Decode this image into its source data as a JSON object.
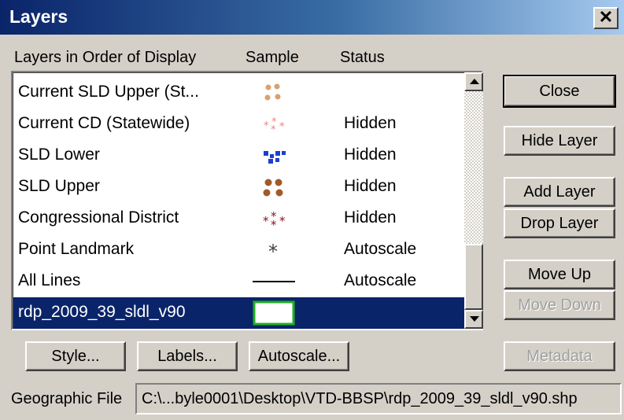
{
  "window": {
    "title": "Layers",
    "close_glyph": "✕"
  },
  "columns": {
    "name": "Layers in Order of Display",
    "sample": "Sample",
    "status": "Status"
  },
  "layers": [
    {
      "name": "Current SLD Upper (St...",
      "sample": "brown-dots",
      "status": ""
    },
    {
      "name": "Current CD (Statewide)",
      "sample": "pink-stars",
      "status": "Hidden"
    },
    {
      "name": "SLD Lower",
      "sample": "blue-squares",
      "status": "Hidden"
    },
    {
      "name": "SLD Upper",
      "sample": "brown-blobs",
      "status": "Hidden"
    },
    {
      "name": "Congressional District",
      "sample": "red-stars",
      "status": "Hidden"
    },
    {
      "name": "Point Landmark",
      "sample": "asterisk",
      "status": "Autoscale"
    },
    {
      "name": "All Lines",
      "sample": "line",
      "status": "Autoscale"
    },
    {
      "name": "rdp_2009_39_sldl_v90",
      "sample": "green-rect",
      "status": "",
      "selected": true
    }
  ],
  "buttons": {
    "close": "Close",
    "hide_layer": "Hide Layer",
    "add_layer": "Add Layer",
    "drop_layer": "Drop Layer",
    "move_up": "Move Up",
    "move_down": "Move Down",
    "style": "Style...",
    "labels": "Labels...",
    "autoscale": "Autoscale...",
    "metadata": "Metadata"
  },
  "geographic_file": {
    "label": "Geographic File",
    "value": "C:\\...byle0001\\Desktop\\VTD-BBSP\\rdp_2009_39_sldl_v90.shp"
  },
  "colors": {
    "titlebar_start": "#0a246a",
    "titlebar_end": "#a6caf0",
    "selection": "#0a246a",
    "dialog_face": "#d4d0c8"
  }
}
